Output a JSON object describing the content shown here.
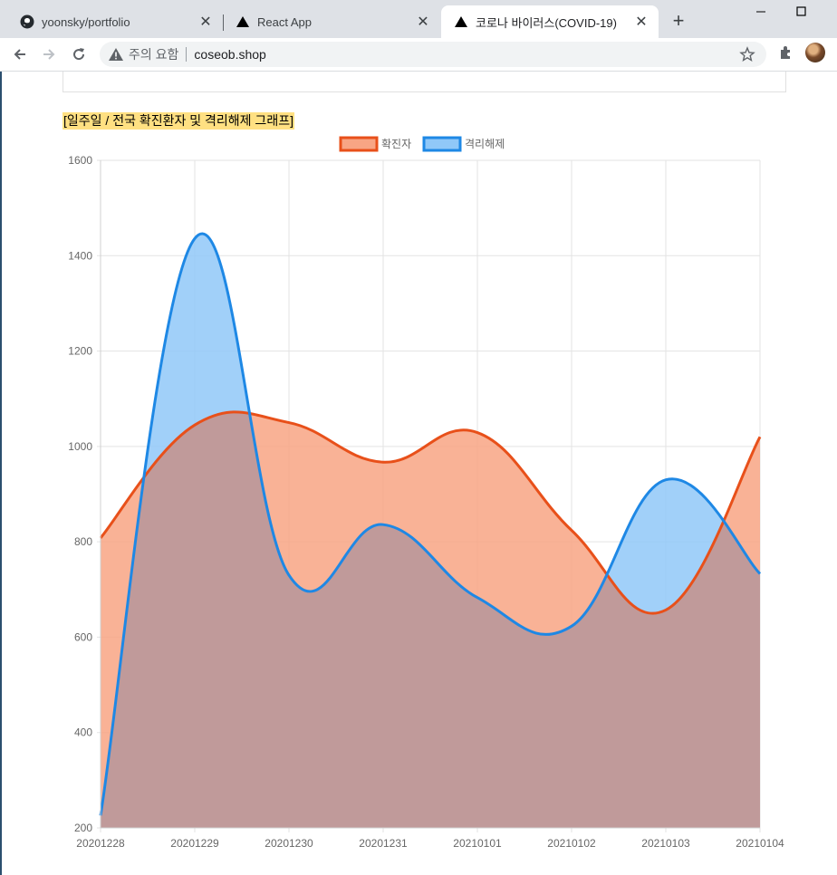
{
  "browser": {
    "tabs": [
      {
        "title": "yoonsky/portfolio",
        "icon": "github-icon"
      },
      {
        "title": "React App",
        "icon": "triangle-icon"
      },
      {
        "title": "코로나 바이러스(COVID-19)",
        "icon": "triangle-icon",
        "active": true
      }
    ],
    "security_warning": "주의 요함",
    "url": "coseob.shop"
  },
  "page": {
    "chart_heading": "[일주일 / 전국 확진환자 및 격리해제 그래프]"
  },
  "colors": {
    "confirmed_line": "#e8501a",
    "confirmed_fill": "#f8a584",
    "released_line": "#1e88e5",
    "released_fill": "#90c8f8"
  },
  "chart_data": {
    "type": "area",
    "x": [
      "20201228",
      "20201229",
      "20201230",
      "20201231",
      "20210101",
      "20210102",
      "20210103",
      "20210104"
    ],
    "series": [
      {
        "name": "확진자",
        "values": [
          808,
          1045,
          1050,
          967,
          1029,
          824,
          657,
          1020
        ]
      },
      {
        "name": "격리해제",
        "values": [
          226,
          1436,
          730,
          836,
          683,
          623,
          930,
          733
        ]
      }
    ],
    "ylim": [
      200,
      1600
    ],
    "yticks": [
      200,
      400,
      600,
      800,
      1000,
      1200,
      1400,
      1600
    ],
    "legend": "top-center",
    "grid": true
  }
}
